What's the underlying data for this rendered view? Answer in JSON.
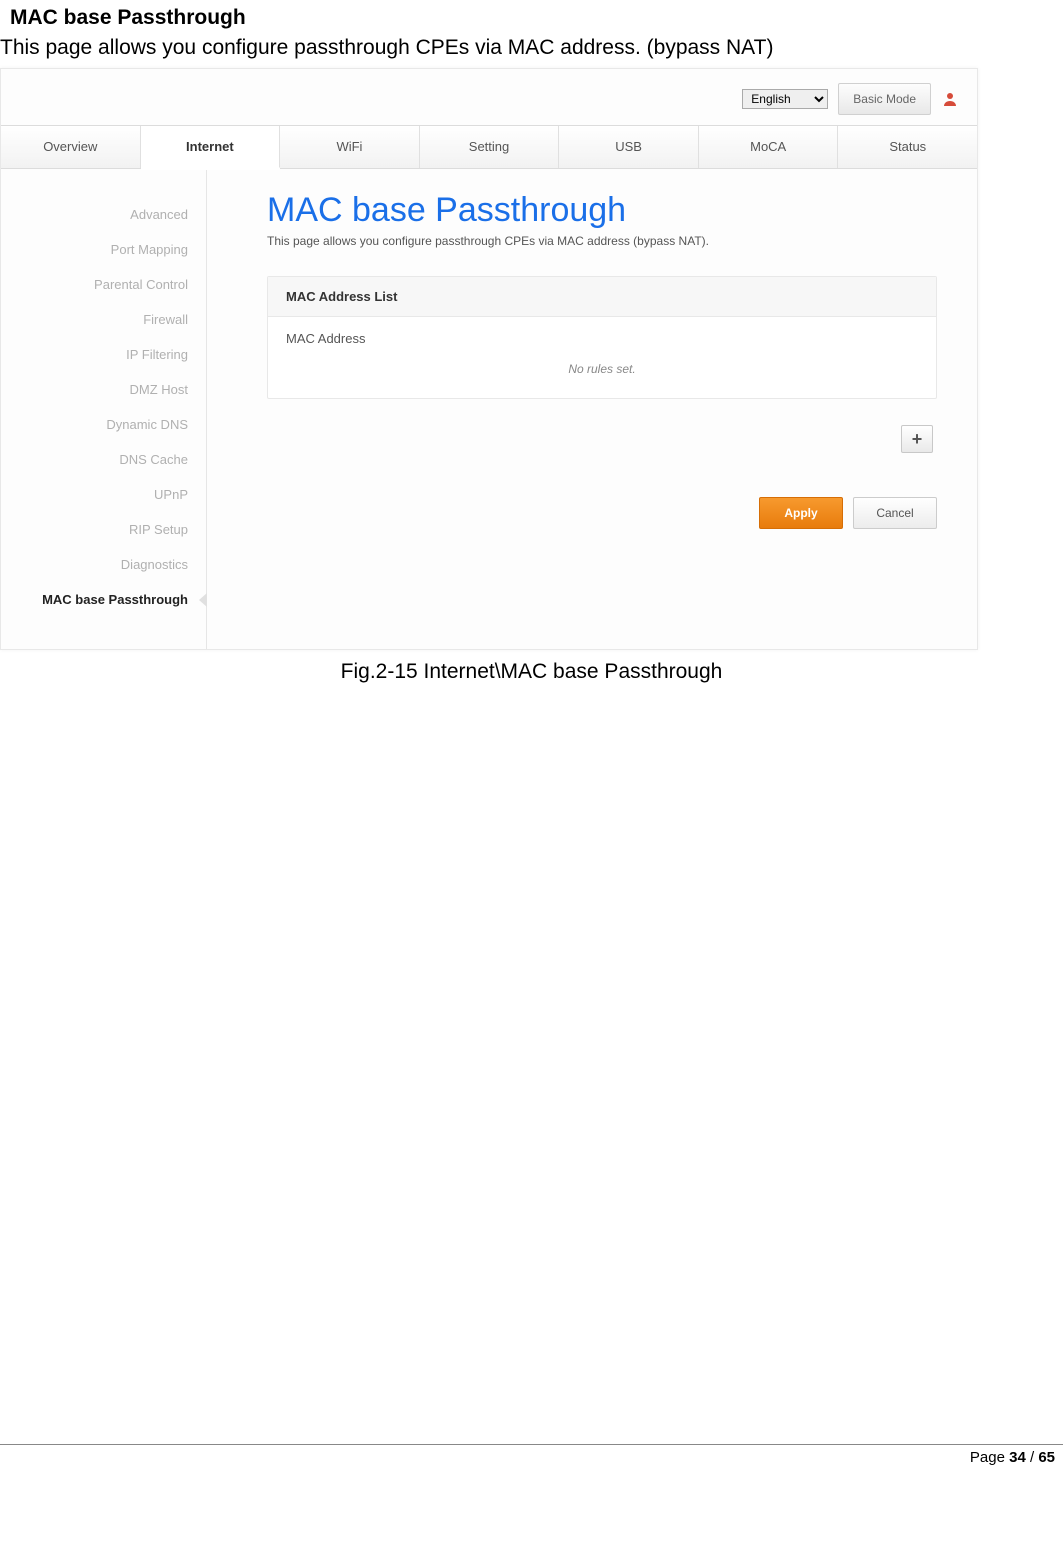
{
  "doc": {
    "section_title": "MAC base Passthrough",
    "section_text": "This page allows you configure passthrough CPEs via MAC address. (bypass NAT)",
    "caption": "Fig.2-15 Internet\\MAC base Passthrough",
    "page_label_prefix": "Page ",
    "page_current": "34",
    "page_sep": " / ",
    "page_total": "65"
  },
  "topbar": {
    "language": "English",
    "mode_button": "Basic Mode"
  },
  "tabs": [
    "Overview",
    "Internet",
    "WiFi",
    "Setting",
    "USB",
    "MoCA",
    "Status"
  ],
  "active_tab_index": 1,
  "sidebar": {
    "items": [
      "Advanced",
      "Port Mapping",
      "Parental Control",
      "Firewall",
      "IP Filtering",
      "DMZ Host",
      "Dynamic DNS",
      "DNS Cache",
      "UPnP",
      "RIP Setup",
      "Diagnostics",
      "MAC base Passthrough"
    ],
    "active_index": 11
  },
  "page": {
    "heading": "MAC base Passthrough",
    "description": "This page allows you configure passthrough CPEs via MAC address (bypass NAT).",
    "panel_title": "MAC Address List",
    "column_label": "MAC Address",
    "empty_text": "No rules set.",
    "add_symbol": "+",
    "apply_label": "Apply",
    "cancel_label": "Cancel"
  }
}
